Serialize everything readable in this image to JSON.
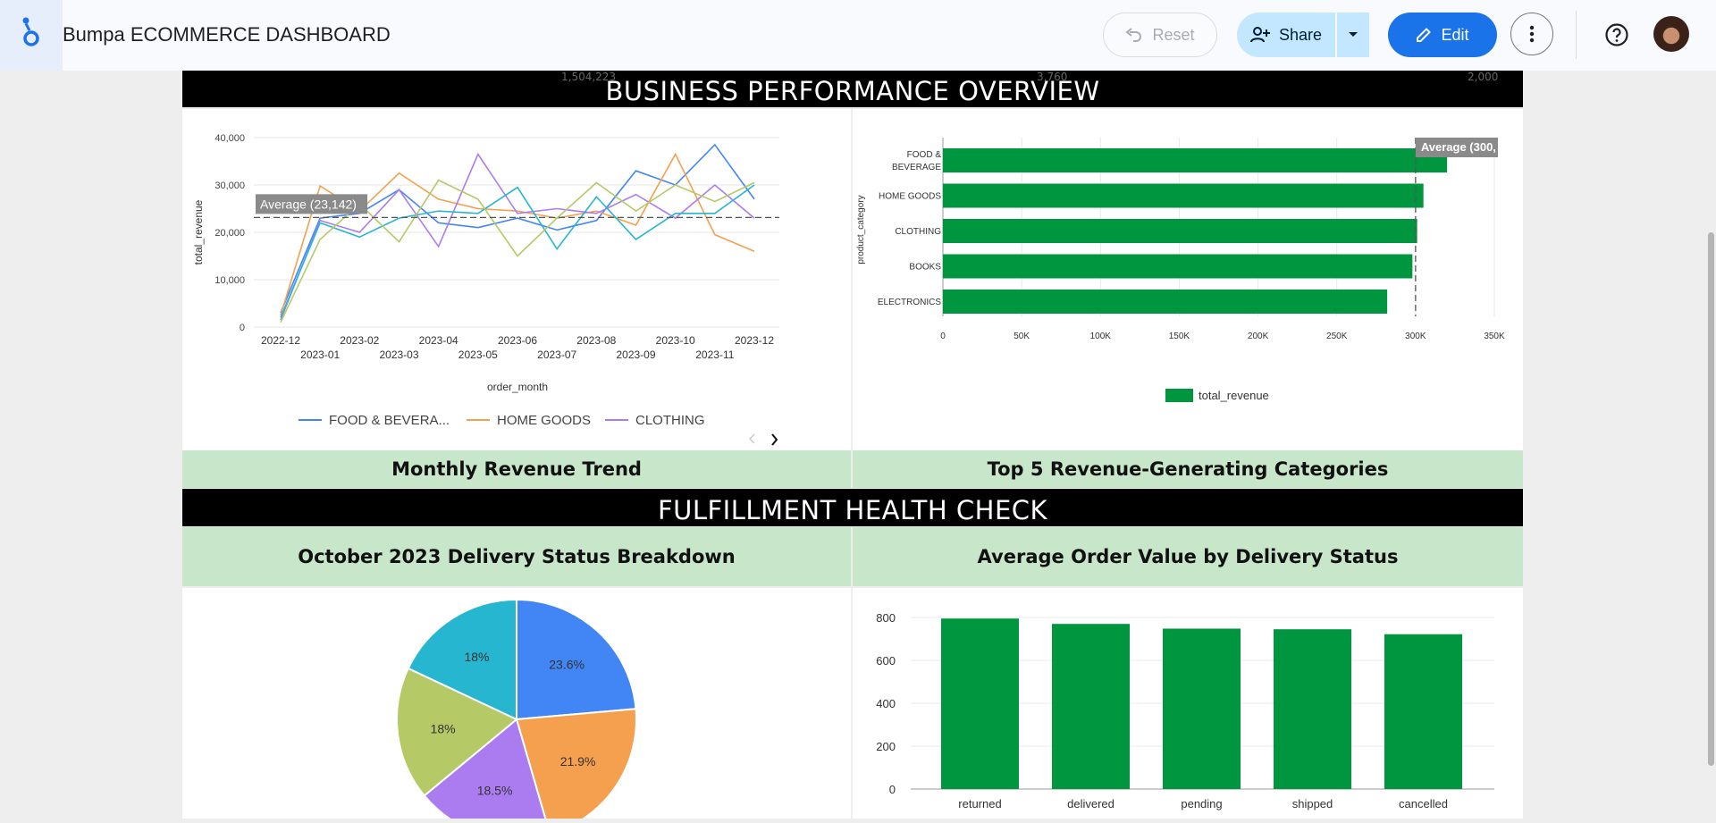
{
  "app": {
    "title": "Bumpa ECOMMERCE DASHBOARD"
  },
  "toolbar": {
    "reset_label": "Reset",
    "share_label": "Share",
    "edit_label": "Edit"
  },
  "icons": {
    "logo": "looker-studio-logo-icon",
    "reset": "undo-icon",
    "share": "person-add-icon",
    "share_dropdown": "caret-down-icon",
    "edit": "pencil-icon",
    "more": "more-vert-icon",
    "help": "help-circle-icon"
  },
  "colors": {
    "header_banner": "#000000",
    "caption_bg": "#c8e6c9",
    "primary": "#1a73e8",
    "bar_green": "#00963f"
  },
  "sections": {
    "performance": {
      "banner": "BUSINESS PERFORMANCE OVERVIEW",
      "faint_values": [
        "1,504,223",
        "3,760",
        "2,000"
      ]
    },
    "fulfillment": {
      "banner": "FULFILLMENT HEALTH CHECK"
    }
  },
  "captions": {
    "line": "Monthly Revenue Trend",
    "hbar": "Top 5 Revenue-Generating Categories",
    "pie": "October 2023 Delivery Status Breakdown",
    "vbar": "Average Order Value by Delivery Status"
  },
  "chart_data": [
    {
      "type": "line",
      "xlabel": "order_month",
      "ylabel": "total_revenue",
      "ylim": [
        0,
        40000
      ],
      "yticks": [
        "0",
        "10,000",
        "20,000",
        "30,000",
        "40,000"
      ],
      "categories": [
        "2022-12",
        "2023-01",
        "2023-02",
        "2023-03",
        "2023-04",
        "2023-05",
        "2023-06",
        "2023-07",
        "2023-08",
        "2023-09",
        "2023-10",
        "2023-11",
        "2023-12"
      ],
      "average": {
        "label": "Average (23,142)",
        "value": 23142
      },
      "legend": {
        "placement": "bottom",
        "items": [
          "FOOD & BEVERA...",
          "HOME GOODS",
          "CLOTHING"
        ]
      },
      "series": [
        {
          "name": "FOOD & BEVERAGE",
          "color": "#4285f4",
          "values": [
            3000,
            23000,
            24000,
            29000,
            22000,
            21000,
            23000,
            20500,
            22500,
            33000,
            30000,
            38500,
            27000
          ]
        },
        {
          "name": "HOME GOODS",
          "color": "#f4a04e",
          "values": [
            2500,
            29800,
            24500,
            32500,
            27000,
            25000,
            24500,
            23000,
            24500,
            21500,
            36500,
            19500,
            16000
          ]
        },
        {
          "name": "CLOTHING",
          "color": "#ab7cf0",
          "values": [
            1500,
            22500,
            20000,
            29000,
            17000,
            36500,
            24000,
            25000,
            24000,
            28000,
            23000,
            30000,
            23000
          ]
        },
        {
          "color": "#26b6cf",
          "values": [
            2000,
            22000,
            19000,
            23000,
            24500,
            24000,
            29500,
            16500,
            27500,
            18500,
            24000,
            24000,
            30000
          ]
        },
        {
          "color": "#b5c966",
          "values": [
            1000,
            18500,
            26000,
            18000,
            31000,
            27000,
            15000,
            23000,
            30500,
            24500,
            30000,
            26500,
            30500
          ]
        }
      ]
    },
    {
      "type": "bar",
      "orientation": "horizontal",
      "ylabel": "product_category",
      "categories": [
        "FOOD & BEVERAGE",
        "HOME GOODS",
        "CLOTHING",
        "BOOKS",
        "ELECTRONICS"
      ],
      "category_lines": [
        [
          "FOOD &",
          "BEVERAGE"
        ],
        [
          "HOME GOODS"
        ],
        [
          "CLOTHING"
        ],
        [
          "BOOKS"
        ],
        [
          "ELECTRONICS"
        ]
      ],
      "values": [
        320000,
        305000,
        301000,
        298000,
        282000
      ],
      "xlim": [
        0,
        350000
      ],
      "xticks": [
        "0",
        "50K",
        "100K",
        "150K",
        "200K",
        "250K",
        "300K",
        "350K"
      ],
      "average": {
        "label": "Average (300,",
        "value": 300000
      },
      "legend": {
        "placement": "bottom",
        "items": [
          "total_revenue"
        ]
      }
    },
    {
      "type": "pie",
      "slices": [
        {
          "label": "23.6%",
          "value": 23.6,
          "color": "#4285f4"
        },
        {
          "label": "21.9%",
          "value": 21.9,
          "color": "#f4a04e"
        },
        {
          "label": "18.5%",
          "value": 18.5,
          "color": "#ab7cf0"
        },
        {
          "label": "18%",
          "value": 18,
          "color": "#b5c966"
        },
        {
          "label": "18%",
          "value": 18,
          "color": "#26b6cf"
        }
      ]
    },
    {
      "type": "bar",
      "orientation": "vertical",
      "categories": [
        "returned",
        "delivered",
        "pending",
        "shipped",
        "cancelled"
      ],
      "values": [
        795,
        770,
        748,
        745,
        722
      ],
      "ylim": [
        0,
        800
      ],
      "yticks": [
        "0",
        "200",
        "400",
        "600",
        "800"
      ]
    }
  ]
}
